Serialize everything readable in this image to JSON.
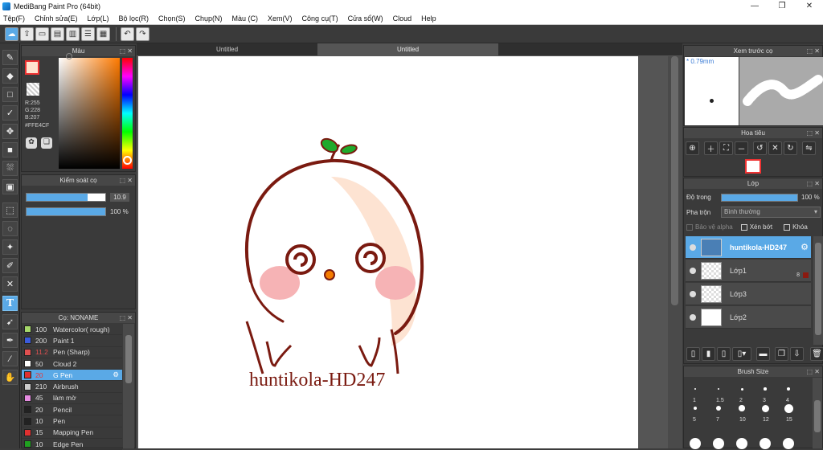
{
  "window": {
    "title": "MediBang Paint Pro (64bit)",
    "min": "—",
    "max": "❐",
    "close": "✕"
  },
  "menu": [
    "Tệp(F)",
    "Chỉnh sửa(E)",
    "Lớp(L)",
    "Bộ lọc(R)",
    "Chọn(S)",
    "Chụp(N)",
    "Màu (C)",
    "Xem(V)",
    "Công cụ(T)",
    "Cửa sổ(W)",
    "Cloud",
    "Help"
  ],
  "color_panel": {
    "title": "Màu",
    "r": "R:255",
    "g": "G:228",
    "b": "B:207",
    "hex": "#FFE4CF",
    "fg": "#FFE4CF"
  },
  "brush_control": {
    "title": "Kiểm soát cọ",
    "size": "10.9",
    "opacity": "100 %",
    "size_fraction": 0.78,
    "opacity_fraction": 1.0
  },
  "brush_panel": {
    "title": "Cọ: NONAME",
    "items": [
      {
        "size": "100",
        "name": "Watercolor( rough)",
        "color": "#a6d96a"
      },
      {
        "size": "200",
        "name": "Paint 1",
        "color": "#3b5bdb"
      },
      {
        "size": "11.2",
        "name": "Pen (Sharp)",
        "color": "#e05050",
        "size_color": "#e05050"
      },
      {
        "size": "50",
        "name": "Cloud 2",
        "color": "#ffffff"
      },
      {
        "size": "20",
        "name": "G Pen",
        "color": "#e03030",
        "selected": true
      },
      {
        "size": "210",
        "name": "Airbrush",
        "color": "#cccccc"
      },
      {
        "size": "45",
        "name": "làm mờ",
        "color": "#e58be0"
      },
      {
        "size": "20",
        "name": "Pencil",
        "color": "#222222"
      },
      {
        "size": "10",
        "name": "Pen",
        "color": "#222222"
      },
      {
        "size": "15",
        "name": "Mapping Pen",
        "color": "#e03030"
      },
      {
        "size": "10",
        "name": "Edge Pen",
        "color": "#20a020"
      }
    ]
  },
  "tabs": [
    "Untitled",
    "Untitled"
  ],
  "canvas_text": "huntikola-HD247",
  "preview": {
    "title": "Xem trước cọ",
    "size": "* 0.79mm"
  },
  "navigator": {
    "title": "Hoa tiêu"
  },
  "layer_panel": {
    "title": "Lớp",
    "opacity_label": "Độ trong",
    "opacity_value": "100 %",
    "blend_label": "Pha trộn",
    "blend_value": "Bình thường",
    "protect_alpha": "Bảo vệ alpha",
    "clipping": "Xén bớt",
    "lock": "Khóa",
    "layers": [
      {
        "name": "huntikola-HD247",
        "selected": true
      },
      {
        "name": "Lớp1"
      },
      {
        "name": "Lớp3"
      },
      {
        "name": "Lớp2"
      }
    ],
    "layer1_badge": "8"
  },
  "brush_size_panel": {
    "title": "Brush Size",
    "labels": [
      "1",
      "1.5",
      "2",
      "3",
      "4",
      "5",
      "7",
      "10",
      "12",
      "15"
    ]
  }
}
